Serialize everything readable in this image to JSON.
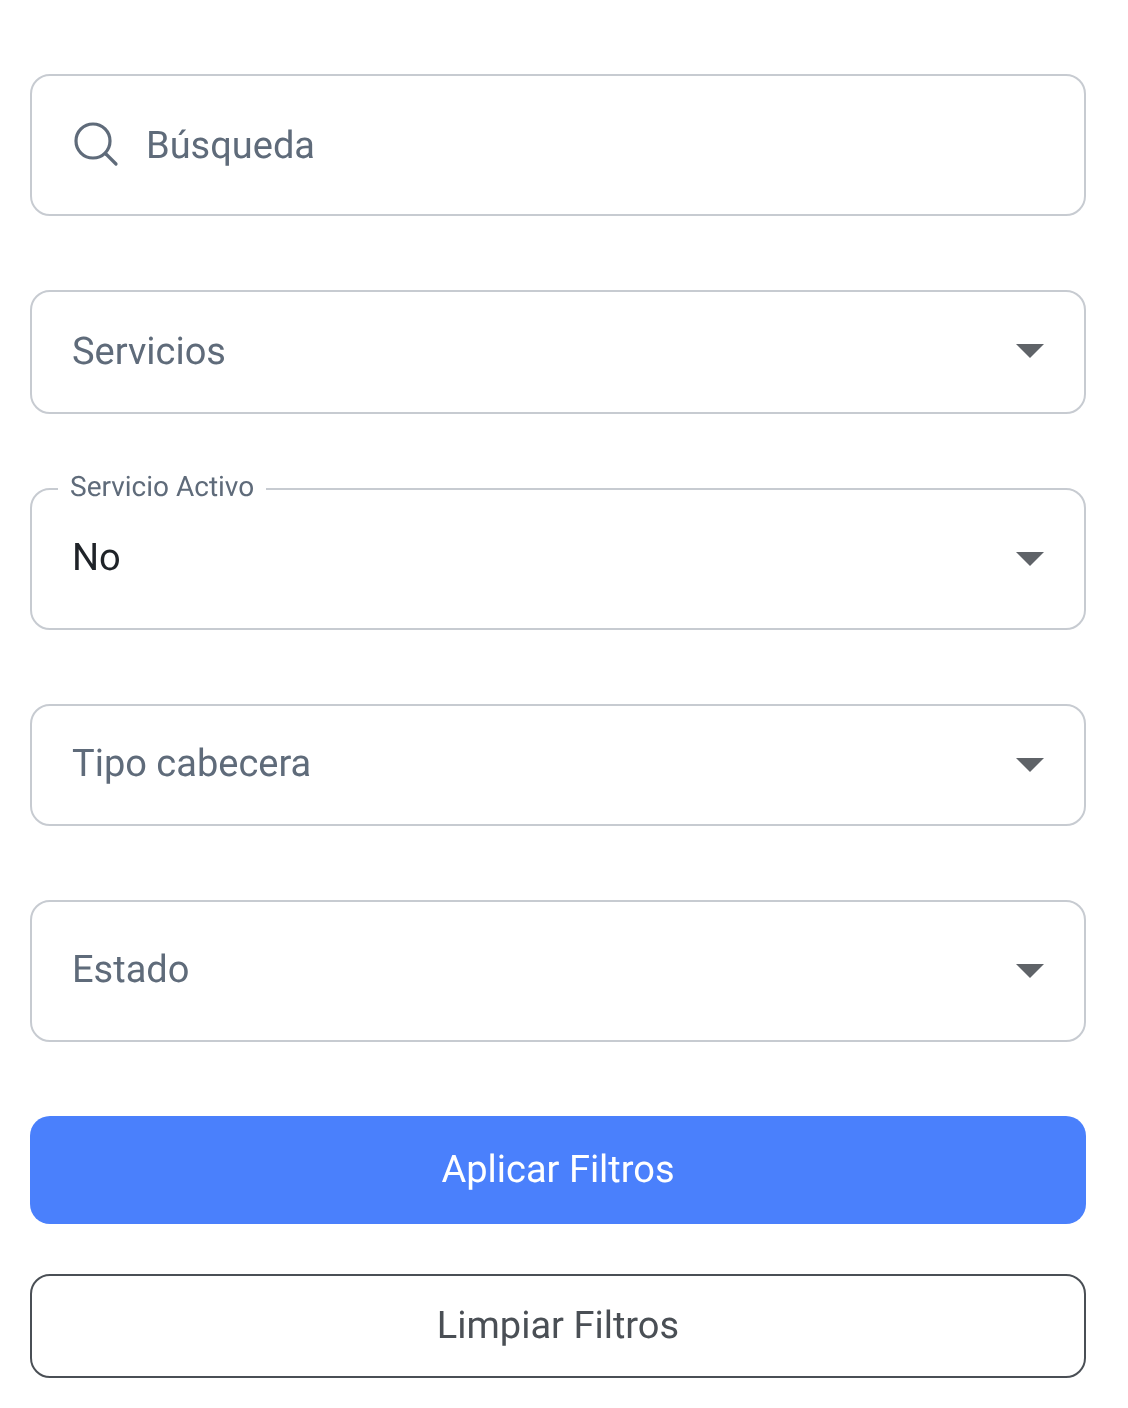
{
  "search": {
    "placeholder": "Búsqueda"
  },
  "selects": [
    {
      "placeholder": "Servicios"
    },
    {
      "label": "Servicio Activo",
      "value": "No"
    },
    {
      "placeholder": "Tipo cabecera"
    },
    {
      "placeholder": "Estado"
    }
  ],
  "buttons": [
    {
      "label": "Aplicar Filtros",
      "kind": "primary"
    },
    {
      "label": "Limpiar Filtros",
      "kind": "secondary"
    }
  ]
}
